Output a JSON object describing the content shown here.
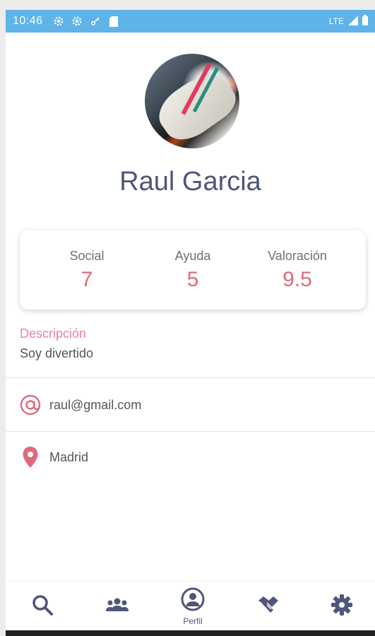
{
  "status_bar": {
    "time": "10:46",
    "network": "LTE"
  },
  "profile": {
    "name": "Raul Garcia"
  },
  "stats": [
    {
      "label": "Social",
      "value": "7"
    },
    {
      "label": "Ayuda",
      "value": "5"
    },
    {
      "label": "Valoración",
      "value": "9.5"
    }
  ],
  "description": {
    "label": "Descripción",
    "text": "Soy divertido"
  },
  "contact": {
    "email": "raul@gmail.com",
    "location": "Madrid"
  },
  "bottom_nav": {
    "items": [
      {
        "icon": "search-icon",
        "label": ""
      },
      {
        "icon": "people-icon",
        "label": ""
      },
      {
        "icon": "profile-icon",
        "label": "Perfil"
      },
      {
        "icon": "handshake-icon",
        "label": ""
      },
      {
        "icon": "gear-icon",
        "label": ""
      }
    ]
  },
  "colors": {
    "status_bar": "#5fb3e8",
    "accent": "#e0697d",
    "name": "#4f5679"
  }
}
